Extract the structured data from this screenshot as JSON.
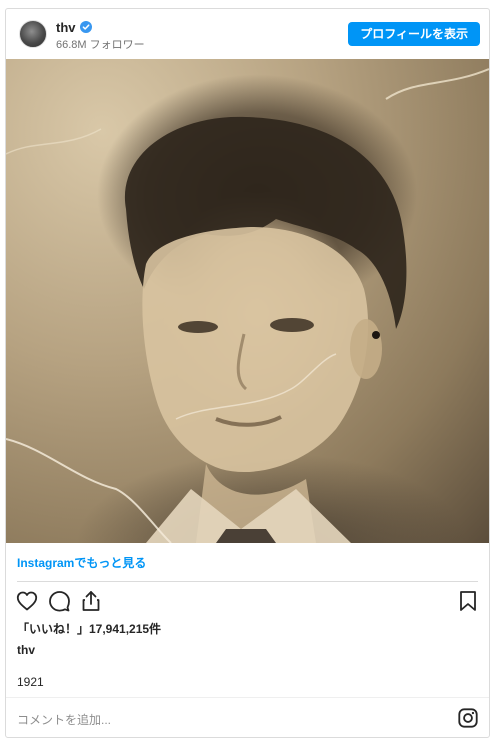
{
  "header": {
    "username": "thv",
    "followers": "66.8M フォロワー",
    "profile_button_label": "プロフィールを表示",
    "verified_icon": "verified-badge-icon",
    "avatar_icon": "avatar"
  },
  "post": {
    "image_icon": "post-photo",
    "more_link_label": "Instagramでもっと見る"
  },
  "actions": {
    "like_icon": "heart-icon",
    "comment_icon": "comment-icon",
    "share_icon": "share-icon",
    "save_icon": "bookmark-icon"
  },
  "likes_label": "「いいね！」17,941,215件",
  "caption": {
    "username": "thv",
    "text": "1921"
  },
  "comment": {
    "placeholder": "コメントを追加..."
  },
  "footer": {
    "instagram_icon": "instagram-icon"
  },
  "colors": {
    "accent": "#0095f6",
    "text": "#262626",
    "muted": "#737373",
    "border": "#dbdbdb"
  }
}
